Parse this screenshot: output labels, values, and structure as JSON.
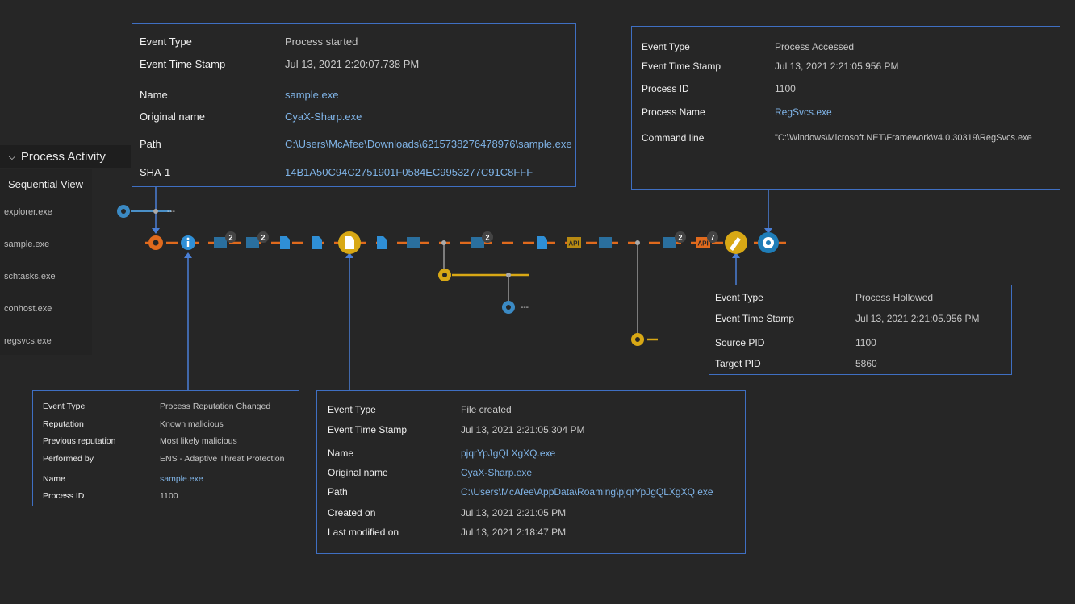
{
  "sidebar": {
    "section_title": "Process Activity",
    "sequential_view_label": "Sequential View",
    "processes": [
      "explorer.exe",
      "sample.exe",
      "schtasks.exe",
      "conhost.exe",
      "regsvcs.exe"
    ]
  },
  "timeline": {
    "badges": [
      "2",
      "2",
      "2",
      "2",
      "7"
    ],
    "api_label": "API",
    "trail": "---"
  },
  "panel_process_started": {
    "rows": [
      {
        "key": "Event Type",
        "value": "Process started"
      },
      {
        "key": "Event Time Stamp",
        "value": "Jul 13, 2021 2:20:07.738 PM"
      },
      {
        "key": "Name",
        "value": "sample.exe"
      },
      {
        "key": "Original name",
        "value": "CyaX-Sharp.exe"
      },
      {
        "key": "Path",
        "value": "C:\\Users\\McAfee\\Downloads\\6215738276478976\\sample.exe"
      },
      {
        "key": "SHA-1",
        "value": "14B1A50C94C2751901F0584EC9953277C91C8FFF"
      }
    ]
  },
  "panel_process_accessed": {
    "rows": [
      {
        "key": "Event Type",
        "value": "Process Accessed"
      },
      {
        "key": "Event Time Stamp",
        "value": "Jul 13, 2021 2:21:05.956 PM"
      },
      {
        "key": "Process ID",
        "value": "1100"
      },
      {
        "key": "Process Name",
        "value": "RegSvcs.exe"
      },
      {
        "key": "Command line",
        "value": "\"C:\\Windows\\Microsoft.NET\\Framework\\v4.0.30319\\RegSvcs.exe"
      }
    ]
  },
  "panel_process_hollowed": {
    "rows": [
      {
        "key": "Event Type",
        "value": "Process Hollowed"
      },
      {
        "key": "Event Time Stamp",
        "value": "Jul 13, 2021 2:21:05.956 PM"
      },
      {
        "key": "Source PID",
        "value": "1100"
      },
      {
        "key": "Target PID",
        "value": "5860"
      }
    ]
  },
  "panel_reputation": {
    "rows": [
      {
        "key": "Event Type",
        "value": "Process Reputation Changed"
      },
      {
        "key": "Reputation",
        "value": "Known malicious"
      },
      {
        "key": "Previous reputation",
        "value": "Most likely malicious"
      },
      {
        "key": "Performed by",
        "value": "ENS - Adaptive Threat Protection"
      },
      {
        "key": "Name",
        "value": "sample.exe"
      },
      {
        "key": "Process ID",
        "value": "1100"
      }
    ]
  },
  "panel_file_created": {
    "rows": [
      {
        "key": "Event Type",
        "value": "File created"
      },
      {
        "key": "Event Time Stamp",
        "value": "Jul 13, 2021 2:21:05.304 PM"
      },
      {
        "key": "Name",
        "value": "pjqrYpJgQLXgXQ.exe"
      },
      {
        "key": "Original name",
        "value": "CyaX-Sharp.exe"
      },
      {
        "key": "Path",
        "value": "C:\\Users\\McAfee\\AppData\\Roaming\\pjqrYpJgQLXgXQ.exe"
      },
      {
        "key": "Created on",
        "value": "Jul 13, 2021 2:21:05 PM"
      },
      {
        "key": "Last modified on",
        "value": "Jul 13, 2021 2:18:47 PM"
      }
    ]
  }
}
